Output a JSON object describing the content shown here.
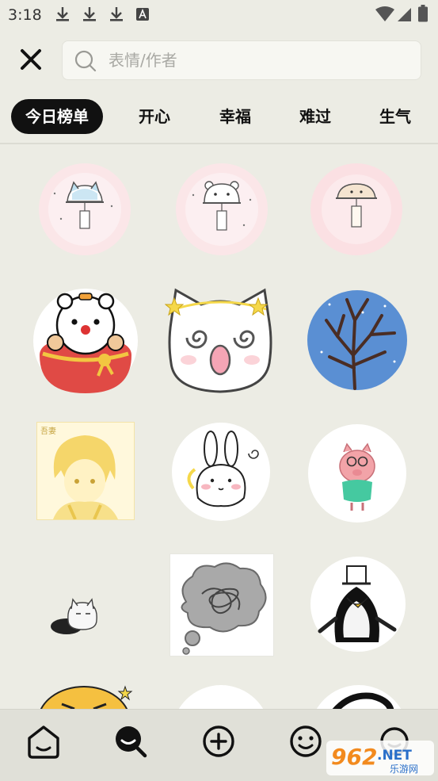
{
  "status": {
    "time": "3:18",
    "notification_icons": [
      "download-icon",
      "download-icon",
      "download-icon",
      "font-a-icon"
    ],
    "system_icons": [
      "wifi-icon",
      "signal-icon",
      "battery-icon"
    ]
  },
  "search": {
    "placeholder": "表情/作者",
    "value": ""
  },
  "tabs": [
    {
      "label": "今日榜单",
      "active": true
    },
    {
      "label": "开心",
      "active": false
    },
    {
      "label": "幸福",
      "active": false
    },
    {
      "label": "难过",
      "active": false
    },
    {
      "label": "生气",
      "active": false
    }
  ],
  "stickers": [
    {
      "name": "sticker-cat-wind-chime",
      "row": 1,
      "col": 1
    },
    {
      "name": "sticker-bear-wind-chime",
      "row": 1,
      "col": 2
    },
    {
      "name": "sticker-mushroom-wind-chime",
      "row": 1,
      "col": 3
    },
    {
      "name": "sticker-bear-red-bag",
      "row": 2,
      "col": 1
    },
    {
      "name": "sticker-dizzy-cat",
      "row": 2,
      "col": 2
    },
    {
      "name": "sticker-snow-tree",
      "row": 2,
      "col": 3
    },
    {
      "name": "sticker-anime-boy",
      "row": 3,
      "col": 1
    },
    {
      "name": "sticker-bunny",
      "row": 3,
      "col": 2
    },
    {
      "name": "sticker-pink-pig",
      "row": 3,
      "col": 3
    },
    {
      "name": "sticker-cat-hole",
      "row": 4,
      "col": 1
    },
    {
      "name": "sticker-messy-thought",
      "row": 4,
      "col": 2
    },
    {
      "name": "sticker-penguin-hat",
      "row": 4,
      "col": 3
    }
  ],
  "sticker_labels": {
    "anime_boy_stamp": "吾妻"
  },
  "bottom_nav": [
    {
      "icon": "home-icon",
      "active": false
    },
    {
      "icon": "search-icon",
      "active": true
    },
    {
      "icon": "add-icon",
      "active": false
    },
    {
      "icon": "emoji-icon",
      "active": false
    },
    {
      "icon": "profile-icon",
      "active": false
    }
  ],
  "watermark": {
    "number": "962",
    "suffix": ".NET",
    "site_name": "乐游网"
  },
  "colors": {
    "background": "#ecece4",
    "active_tab_bg": "#111111",
    "active_tab_text": "#ffffff",
    "watermark_orange": "#f28a1e",
    "watermark_blue": "#2a6fc9"
  }
}
